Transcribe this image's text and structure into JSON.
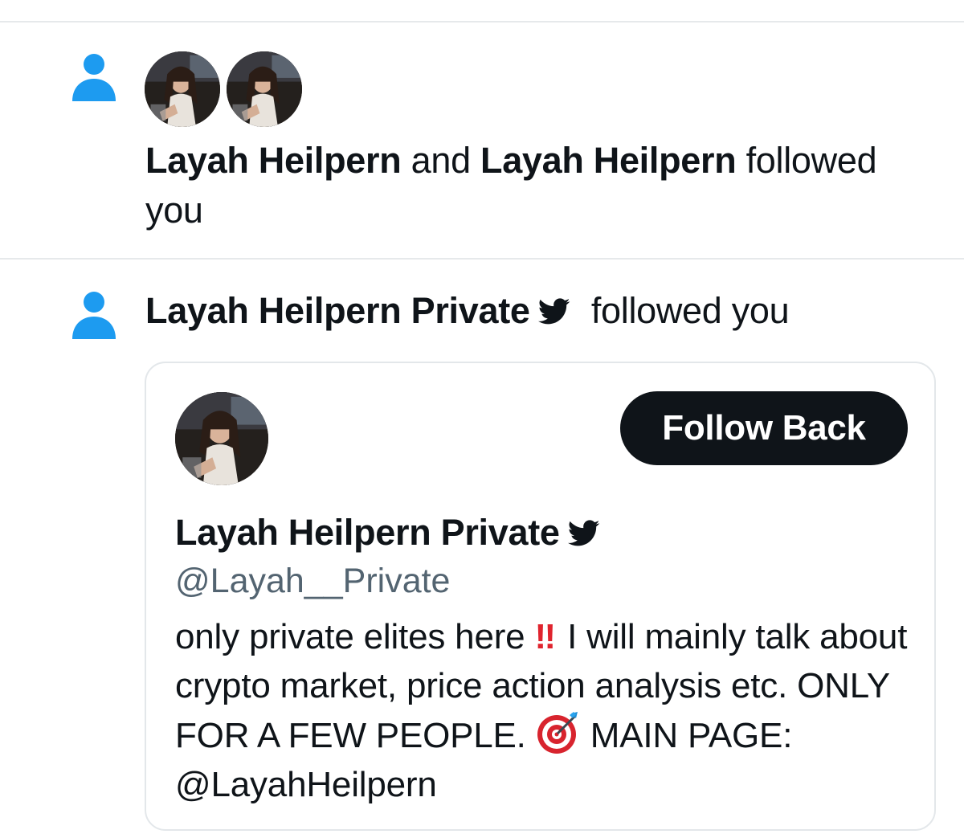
{
  "notifications": [
    {
      "icon": "person-icon",
      "user1": "Layah Heilpern",
      "connector": "and",
      "user2": "Layah Heilpern",
      "action_line1": "followed",
      "action_line2": "you"
    },
    {
      "icon": "person-icon",
      "user": "Layah Heilpern Private",
      "badge_icon": "bird-icon",
      "action": "followed you"
    }
  ],
  "card": {
    "follow_button": "Follow Back",
    "name": "Layah Heilpern Private",
    "badge_icon": "bird-icon",
    "handle": "@Layah__Private",
    "bio_part1": "only private elites here",
    "bio_emoji1": "‼",
    "bio_part2": "I will mainly talk about crypto market, price action analysis etc. ONLY FOR A FEW PEOPLE.",
    "bio_emoji2": "target-icon",
    "bio_part3": "MAIN PAGE: @LayahHeilpern"
  },
  "colors": {
    "accent": "#1d9bf0",
    "button_bg": "#0f1419",
    "secondary_text": "#536471",
    "divider": "#e6e9eb"
  }
}
